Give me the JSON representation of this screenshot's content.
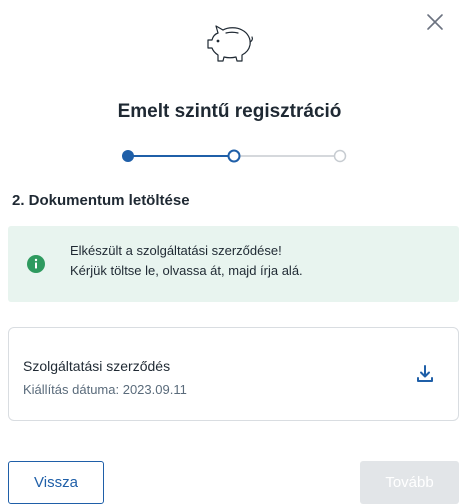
{
  "dialog": {
    "title": "Emelt szintű regisztráció",
    "step_title": "2. Dokumentum letöltése"
  },
  "stepper": {
    "total_steps": 3,
    "current_step": 2,
    "accent_color": "#1f5fa8",
    "inactive_color": "#c7ccd1"
  },
  "info": {
    "line1": "Elkészült a szolgáltatási szerződése!",
    "line2": "Kérjük töltse le, olvassa át, majd írja alá.",
    "icon": "info-icon",
    "icon_color": "#2e9a5f",
    "background": "#e8f4ef"
  },
  "document": {
    "name": "Szolgáltatási szerződés",
    "date_label": "Kiállítás dátuma: 2023.09.11",
    "icon": "download-icon"
  },
  "buttons": {
    "back_label": "Vissza",
    "next_label": "Tovább",
    "next_disabled": true
  },
  "icons": {
    "close": "close-icon",
    "logo": "piggy-bank-icon"
  }
}
